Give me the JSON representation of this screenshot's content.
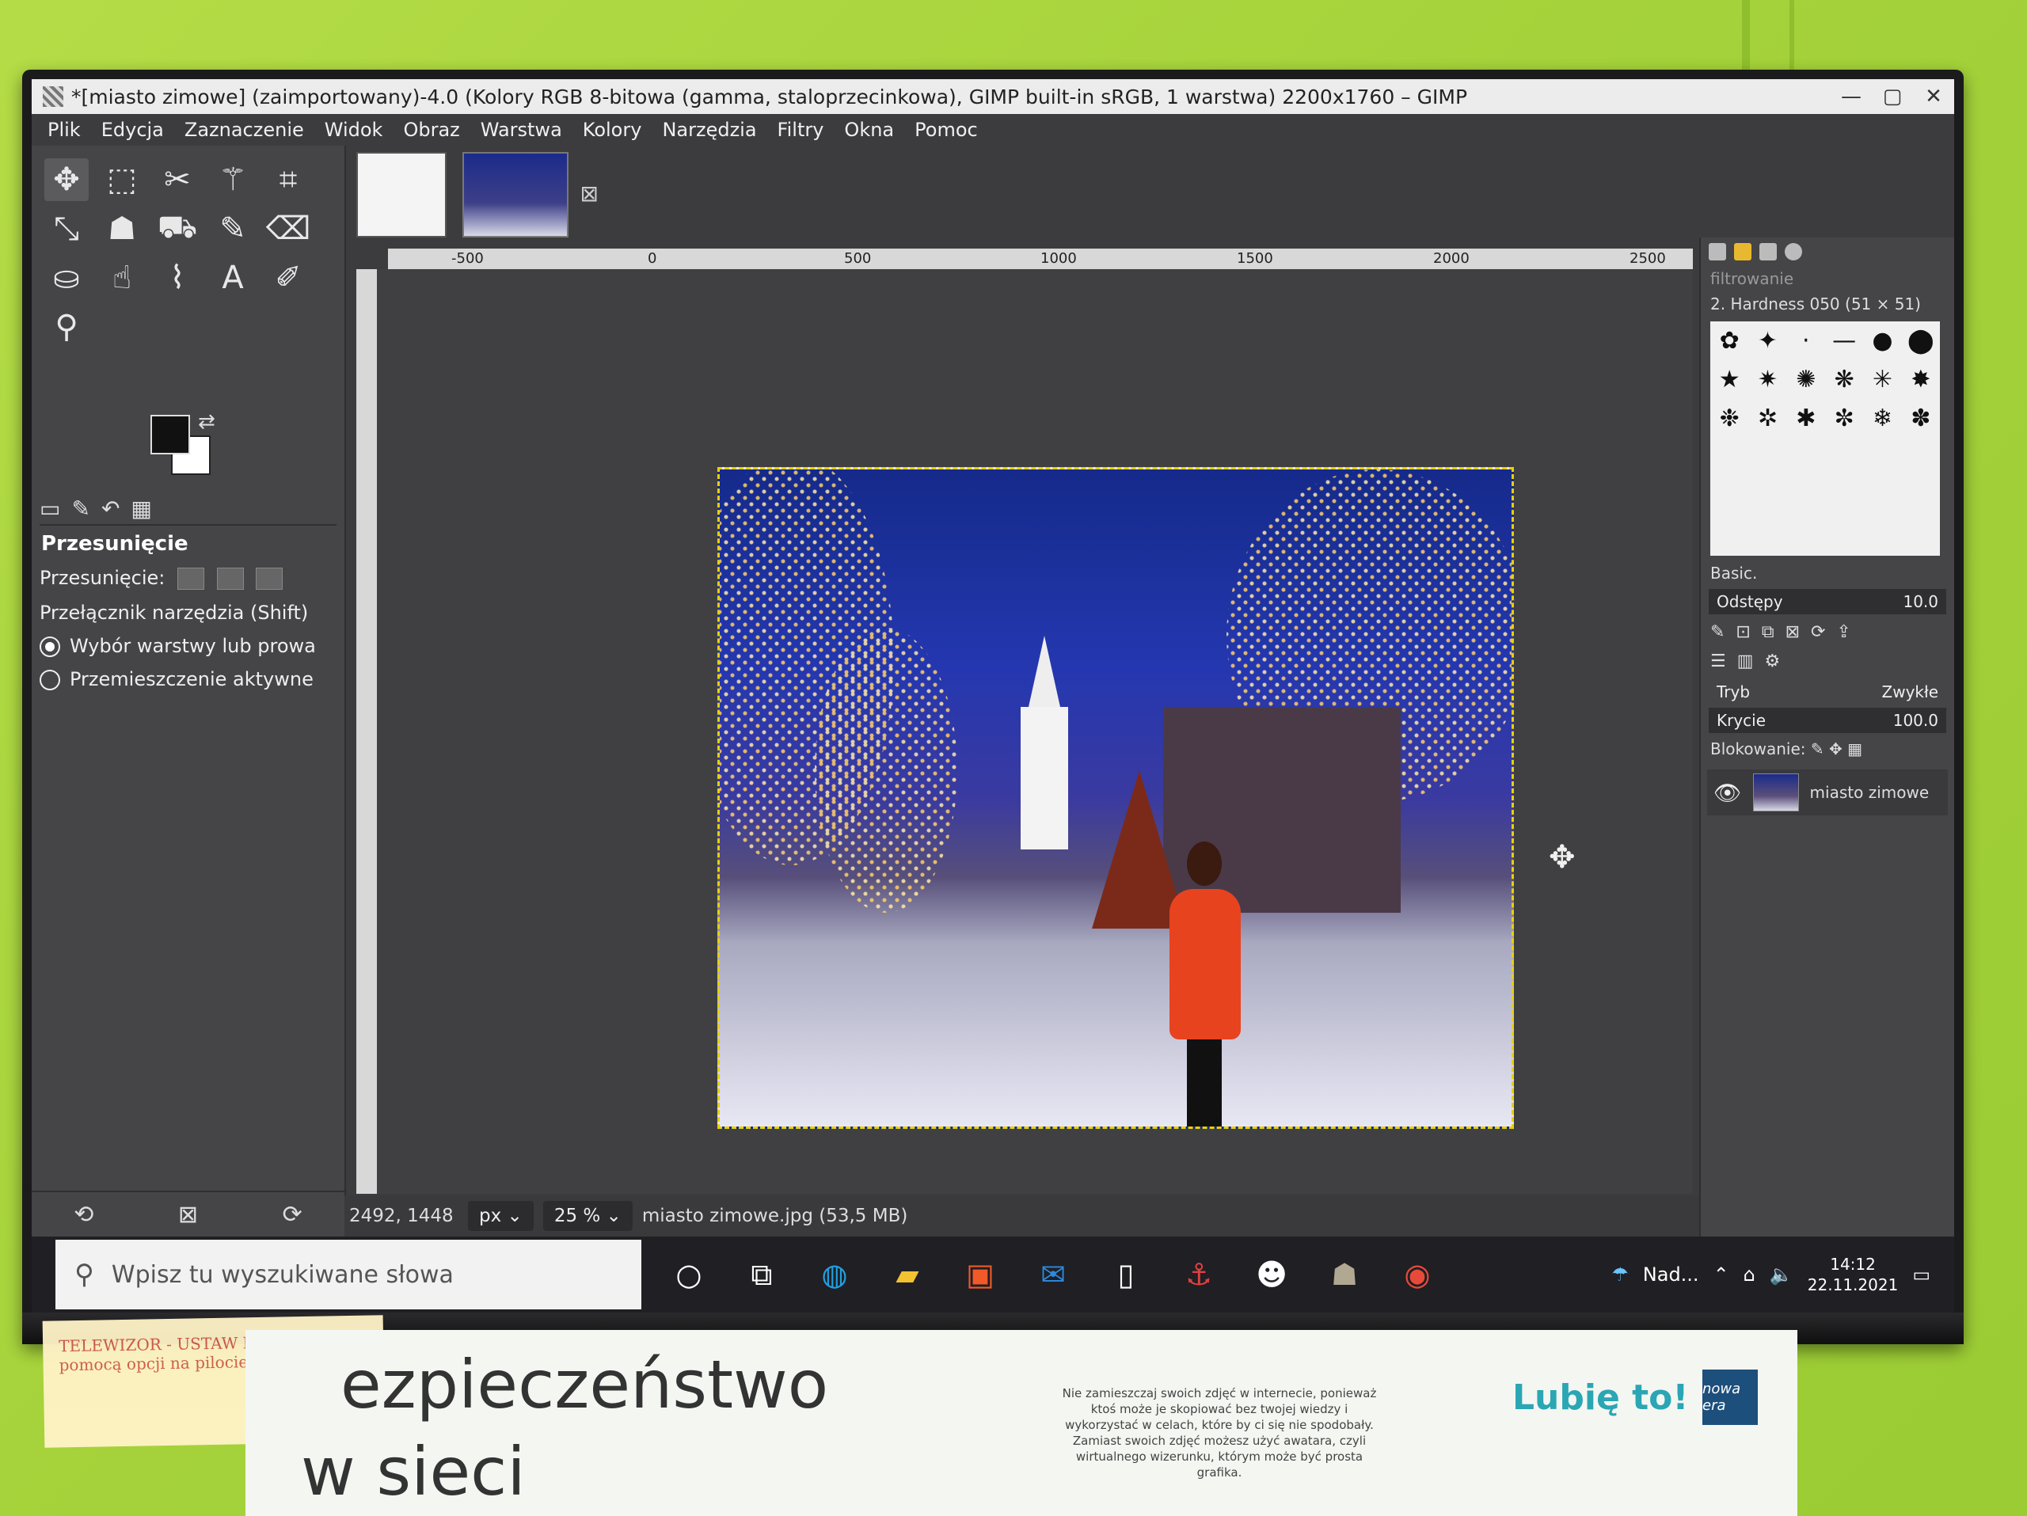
{
  "window": {
    "title": "*[miasto zimowe] (zaimportowany)-4.0 (Kolory RGB 8-bitowa (gamma, staloprzecinkowa), GIMP built-in sRGB, 1 warstwa) 2200x1760 – GIMP",
    "minimize": "—",
    "maximize": "▢",
    "close": "✕"
  },
  "menubar": [
    "Plik",
    "Edycja",
    "Zaznaczenie",
    "Widok",
    "Obraz",
    "Warstwa",
    "Kolory",
    "Narzędzia",
    "Filtry",
    "Okna",
    "Pomoc"
  ],
  "toolbox": {
    "tools": [
      {
        "icon": "move-icon",
        "glyph": "✥"
      },
      {
        "icon": "rect-select-icon",
        "glyph": "⬚"
      },
      {
        "icon": "scissors-select-icon",
        "glyph": "✂"
      },
      {
        "icon": "fuzzy-select-icon",
        "glyph": "⚚"
      },
      {
        "icon": "crop-icon",
        "glyph": "⌗"
      },
      {
        "icon": "rotate-icon",
        "glyph": "⤡"
      },
      {
        "icon": "warp-icon",
        "glyph": "☗"
      },
      {
        "icon": "bucket-fill-icon",
        "glyph": "⛟"
      },
      {
        "icon": "paintbrush-icon",
        "glyph": "✎"
      },
      {
        "icon": "eraser-icon",
        "glyph": "⌫"
      },
      {
        "icon": "clone-icon",
        "glyph": "⛀"
      },
      {
        "icon": "smudge-icon",
        "glyph": "☝"
      },
      {
        "icon": "paths-icon",
        "glyph": "⌇"
      },
      {
        "icon": "text-icon",
        "glyph": "A"
      },
      {
        "icon": "color-picker-icon",
        "glyph": "✐"
      },
      {
        "icon": "zoom-icon",
        "glyph": "⚲"
      }
    ],
    "options_title": "Przesunięcie",
    "move_label": "Przesunięcie:",
    "toggle_label": "Przełącznik narzędzia  (Shift)",
    "radio1": "Wybór warstwy lub prowa",
    "radio2": "Przemieszczenie aktywne"
  },
  "ruler_labels": [
    "-500",
    "0",
    "500",
    "1000",
    "1500",
    "2000",
    "2500"
  ],
  "status": {
    "coords": "2492, 1448",
    "unit": "px",
    "zoom": "25 %",
    "file": "miasto zimowe.jpg (53,5 MB)"
  },
  "right_dock": {
    "filter_placeholder": "filtrowanie",
    "brush_name": "2. Hardness 050 (51 × 51)",
    "brush_set": "Basic.",
    "spacing_label": "Odstępy",
    "spacing_value": "10.0",
    "mode_label": "Tryb",
    "mode_value": "Zwykłe",
    "opacity_label": "Krycie",
    "opacity_value": "100.0",
    "lock_label": "Blokowanie:",
    "layer_name": "miasto zimowe"
  },
  "taskbar": {
    "search_placeholder": "Wpisz tu wyszukiwane słowa",
    "weather": "Nad...",
    "time": "14:12",
    "date": "22.11.2021",
    "icons": [
      {
        "name": "cortana-icon",
        "glyph": "○",
        "color": "#ffffff"
      },
      {
        "name": "task-view-icon",
        "glyph": "⧉",
        "color": "#ffffff"
      },
      {
        "name": "edge-icon",
        "glyph": "◍",
        "color": "#1fa0e0"
      },
      {
        "name": "file-explorer-icon",
        "glyph": "▰",
        "color": "#f2c230"
      },
      {
        "name": "store-icon",
        "glyph": "▣",
        "color": "#f05a28"
      },
      {
        "name": "mail-icon",
        "glyph": "✉",
        "color": "#2b8ae0"
      },
      {
        "name": "notepad-icon",
        "glyph": "▯",
        "color": "#ffffff"
      },
      {
        "name": "app-red-icon",
        "glyph": "⚓",
        "color": "#e04040"
      },
      {
        "name": "app-penguin-icon",
        "glyph": "☻",
        "color": "#ffffff"
      },
      {
        "name": "gimp-icon",
        "glyph": "☗",
        "color": "#b0a890"
      },
      {
        "name": "chrome-icon",
        "glyph": "◉",
        "color": "#e84a3a"
      }
    ]
  },
  "wall": {
    "sticky_note": "TELEWIZOR - USTAW NA (HDMI) za pomocą opcji na pilocie (SOURCE)",
    "poster_title_1": "ezpieczeństwo",
    "poster_title_2": "w sieci",
    "poster_text": "Nie zamieszczaj swoich zdjęć w internecie, ponieważ ktoś może je skopiować bez twojej wiedzy i wykorzystać w celach, które by ci się nie spodobały. Zamiast swoich zdjęć możesz użyć awatara, czyli wirtualnego wizerunku, którym może być prosta grafika.",
    "poster_like": "Lubię to!",
    "poster_logo": "nowa era"
  }
}
